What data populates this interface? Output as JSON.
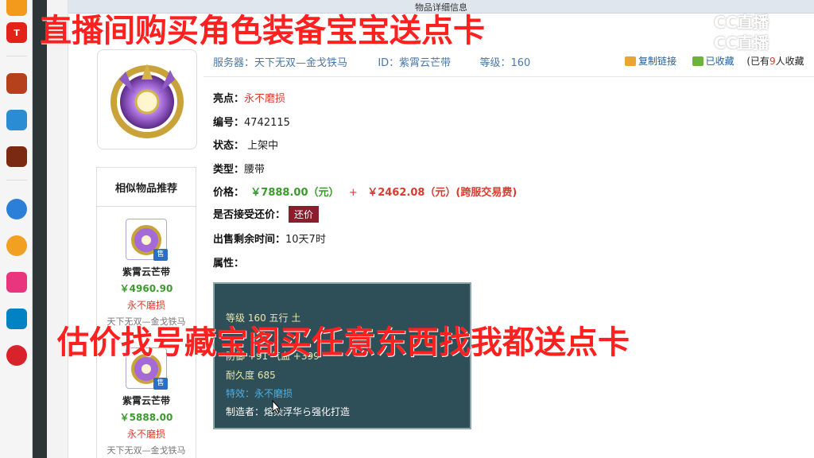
{
  "overlays": {
    "top": "直播间购买角色装备宝宝送点卡",
    "middle": "估价找号藏宝阁买任意东西找我都送点卡"
  },
  "watermark": {
    "line1": "CC直播",
    "line2": "CC直播"
  },
  "page": {
    "section_title": "物品详细信息"
  },
  "header": {
    "server_label": "服务器：",
    "server_value": "天下无双—金戈铁马",
    "id_label": "ID：",
    "id_value": "紫霄云芒带",
    "level_label": "等级：",
    "level_value": "160",
    "copy_link": "复制链接",
    "favorited": "已收藏",
    "fav_count_prefix": "(已有",
    "fav_count": "9",
    "fav_count_suffix": "人收藏"
  },
  "details": {
    "highlight_label": "亮点：",
    "highlight_value": "永不磨损",
    "id_no_label": "编号：",
    "id_no_value": "4742115",
    "status_label": "状态：",
    "status_value": "上架中",
    "type_label": "类型：",
    "type_value": "腰带",
    "price_label": "价格：",
    "price_value": "￥7888.00（元）",
    "plus": "+",
    "fee_value": "￥2462.08（元）(跨服交易费)",
    "counter_label": "是否接受还价：",
    "counter_button": "还价",
    "remaining_label": "出售剩余时间：",
    "remaining_value": "10天7时",
    "attr_label": "属性："
  },
  "tooltip": {
    "line1": "等级 160  五行 土",
    "line2": "防御 +91  气血 +399",
    "line3": "耐久度 685",
    "line4": "特效：永不磨损",
    "line5": "制造者：熔染浮华ら强化打造"
  },
  "similar": {
    "title": "相似物品推荐",
    "items": [
      {
        "name": "紫霄云芒带",
        "price": "￥4960.90",
        "tag": "永不磨损",
        "server": "天下无双—金戈铁马",
        "sale": "售"
      },
      {
        "name": "紫霄云芒带",
        "price": "￥5888.00",
        "tag": "永不磨损",
        "server": "天下无双—金戈铁马",
        "sale": "售"
      }
    ]
  },
  "sidebar_apps": [
    {
      "icon": "orange-app-icon",
      "color": "#f39a1d",
      "text": ""
    },
    {
      "icon": "tmall-icon",
      "color": "#e2231a",
      "text": "T"
    },
    {
      "icon": "game-icon-1",
      "color": "#b5401c",
      "text": ""
    },
    {
      "icon": "game-icon-2",
      "color": "#2a8dd3",
      "text": ""
    },
    {
      "icon": "game-icon-3",
      "color": "#7a2a10",
      "text": ""
    },
    {
      "icon": "browser-icon",
      "color": "#2b7fd6",
      "text": ""
    },
    {
      "icon": "bear-icon",
      "color": "#f2a022",
      "text": ""
    },
    {
      "icon": "pink-app-icon",
      "color": "#e9347e",
      "text": ""
    },
    {
      "icon": "decathlon-icon",
      "color": "#0082c3",
      "text": ""
    },
    {
      "icon": "red-app-icon",
      "color": "#d8232a",
      "text": ""
    }
  ]
}
